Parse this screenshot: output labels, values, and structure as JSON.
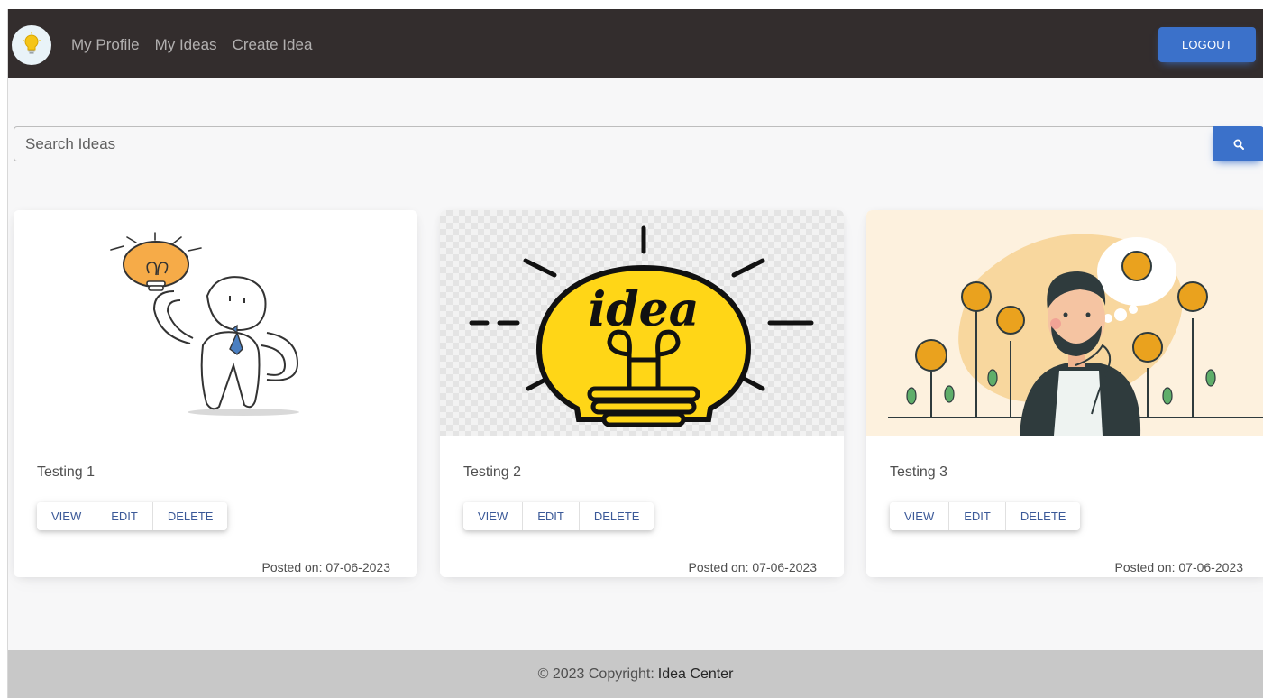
{
  "navbar": {
    "logo_icon": "lightbulb-logo-icon",
    "links": [
      "My Profile",
      "My Ideas",
      "Create Idea"
    ],
    "logout_label": "LOGOUT"
  },
  "search": {
    "placeholder": "Search Ideas",
    "value": "",
    "button_icon": "search-icon"
  },
  "cards": [
    {
      "title": "Testing 1",
      "image_icon": "idea-character-illustration",
      "actions": [
        "VIEW",
        "EDIT",
        "DELETE"
      ],
      "posted": "Posted on: 07-06-2023"
    },
    {
      "title": "Testing 2",
      "image_icon": "idea-lightbulb-illustration",
      "image_text": "idea",
      "actions": [
        "VIEW",
        "EDIT",
        "DELETE"
      ],
      "posted": "Posted on: 07-06-2023"
    },
    {
      "title": "Testing 3",
      "image_icon": "thinking-man-lightbulbs-illustration",
      "actions": [
        "VIEW",
        "EDIT",
        "DELETE"
      ],
      "posted": "Posted on: 07-06-2023"
    }
  ],
  "footer": {
    "copyright": "© 2023 Copyright:",
    "brand": "Idea Center"
  },
  "colors": {
    "navbar": "#332d2d",
    "primary": "#3b71ca",
    "footer": "#c8c8c8"
  }
}
